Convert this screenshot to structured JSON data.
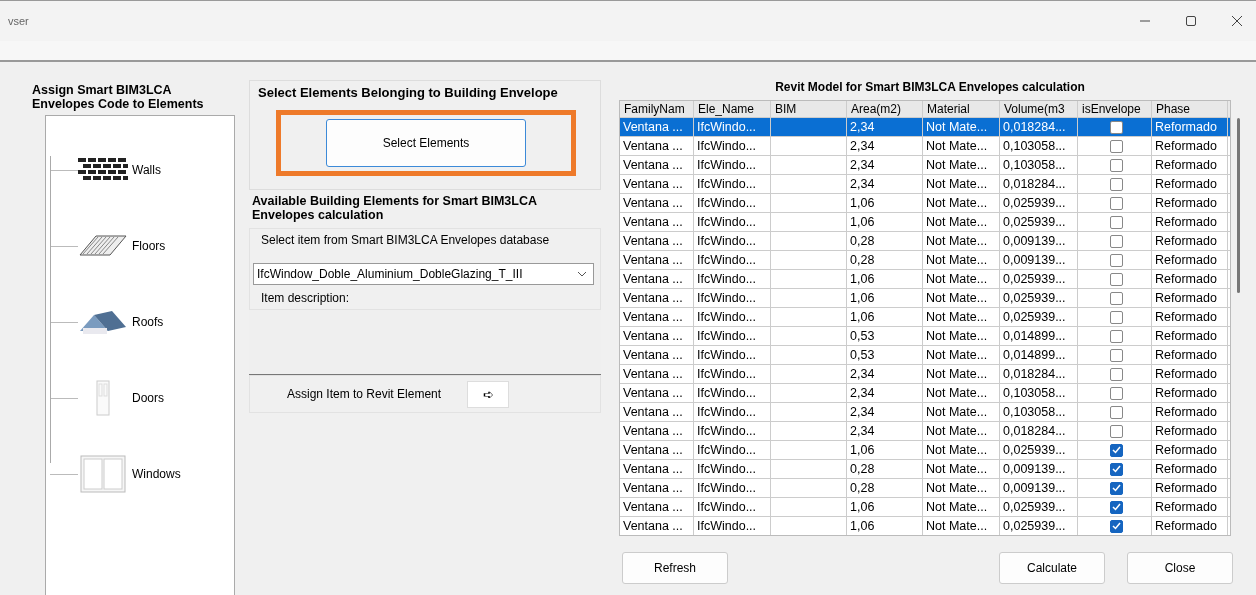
{
  "window": {
    "title": "vser"
  },
  "left_panel": {
    "title": "Assign Smart BIM3LCA Envelopes Code to Elements",
    "tree": [
      {
        "label": "Walls",
        "kind": "walls"
      },
      {
        "label": "Floors",
        "kind": "floors"
      },
      {
        "label": "Roofs",
        "kind": "roofs"
      },
      {
        "label": "Doors",
        "kind": "doors"
      },
      {
        "label": "Windows",
        "kind": "windows"
      }
    ]
  },
  "select_group": {
    "title": "Select Elements Belonging to Building Envelope",
    "button": "Select Elements",
    "highlighted": true
  },
  "available": {
    "title": "Available Building Elements for Smart BIM3LCA Envelopes calculation",
    "group_label": "Select item from Smart BIM3LCA Envelopes database",
    "dropdown_value": "IfcWindow_Doble_Aluminium_DobleGlazing_T_III",
    "description_label": "Item description:",
    "assign_label": "Assign Item to Revit Element",
    "assign_button": "➪"
  },
  "table": {
    "title": "Revit Model for Smart BIM3LCA Envelopes calculation",
    "columns": [
      "FamilyNam",
      "Ele_Name",
      "BIM",
      "Area(m2)",
      "Material",
      "Volume(m3",
      "isEnvelope",
      "Phase"
    ],
    "rows": [
      {
        "family": "Ventana ...",
        "name": "IfcWindo...",
        "bim": "",
        "area": "2,34",
        "material": "Not Mate...",
        "volume": "0,018284...",
        "is_envelope": false,
        "phase": "Reformado",
        "selected": true
      },
      {
        "family": "Ventana ...",
        "name": "IfcWindo...",
        "bim": "",
        "area": "2,34",
        "material": "Not Mate...",
        "volume": "0,103058...",
        "is_envelope": false,
        "phase": "Reformado",
        "selected": false
      },
      {
        "family": "Ventana ...",
        "name": "IfcWindo...",
        "bim": "",
        "area": "2,34",
        "material": "Not Mate...",
        "volume": "0,103058...",
        "is_envelope": false,
        "phase": "Reformado",
        "selected": false
      },
      {
        "family": "Ventana ...",
        "name": "IfcWindo...",
        "bim": "",
        "area": "2,34",
        "material": "Not Mate...",
        "volume": "0,018284...",
        "is_envelope": false,
        "phase": "Reformado",
        "selected": false
      },
      {
        "family": "Ventana ...",
        "name": "IfcWindo...",
        "bim": "",
        "area": "1,06",
        "material": "Not Mate...",
        "volume": "0,025939...",
        "is_envelope": false,
        "phase": "Reformado",
        "selected": false
      },
      {
        "family": "Ventana ...",
        "name": "IfcWindo...",
        "bim": "",
        "area": "1,06",
        "material": "Not Mate...",
        "volume": "0,025939...",
        "is_envelope": false,
        "phase": "Reformado",
        "selected": false
      },
      {
        "family": "Ventana ...",
        "name": "IfcWindo...",
        "bim": "",
        "area": "0,28",
        "material": "Not Mate...",
        "volume": "0,009139...",
        "is_envelope": false,
        "phase": "Reformado",
        "selected": false
      },
      {
        "family": "Ventana ...",
        "name": "IfcWindo...",
        "bim": "",
        "area": "0,28",
        "material": "Not Mate...",
        "volume": "0,009139...",
        "is_envelope": false,
        "phase": "Reformado",
        "selected": false
      },
      {
        "family": "Ventana ...",
        "name": "IfcWindo...",
        "bim": "",
        "area": "1,06",
        "material": "Not Mate...",
        "volume": "0,025939...",
        "is_envelope": false,
        "phase": "Reformado",
        "selected": false
      },
      {
        "family": "Ventana ...",
        "name": "IfcWindo...",
        "bim": "",
        "area": "1,06",
        "material": "Not Mate...",
        "volume": "0,025939...",
        "is_envelope": false,
        "phase": "Reformado",
        "selected": false
      },
      {
        "family": "Ventana ...",
        "name": "IfcWindo...",
        "bim": "",
        "area": "1,06",
        "material": "Not Mate...",
        "volume": "0,025939...",
        "is_envelope": false,
        "phase": "Reformado",
        "selected": false
      },
      {
        "family": "Ventana ...",
        "name": "IfcWindo...",
        "bim": "",
        "area": "0,53",
        "material": "Not Mate...",
        "volume": "0,014899...",
        "is_envelope": false,
        "phase": "Reformado",
        "selected": false
      },
      {
        "family": "Ventana ...",
        "name": "IfcWindo...",
        "bim": "",
        "area": "0,53",
        "material": "Not Mate...",
        "volume": "0,014899...",
        "is_envelope": false,
        "phase": "Reformado",
        "selected": false
      },
      {
        "family": "Ventana ...",
        "name": "IfcWindo...",
        "bim": "",
        "area": "2,34",
        "material": "Not Mate...",
        "volume": "0,018284...",
        "is_envelope": false,
        "phase": "Reformado",
        "selected": false
      },
      {
        "family": "Ventana ...",
        "name": "IfcWindo...",
        "bim": "",
        "area": "2,34",
        "material": "Not Mate...",
        "volume": "0,103058...",
        "is_envelope": false,
        "phase": "Reformado",
        "selected": false
      },
      {
        "family": "Ventana ...",
        "name": "IfcWindo...",
        "bim": "",
        "area": "2,34",
        "material": "Not Mate...",
        "volume": "0,103058...",
        "is_envelope": false,
        "phase": "Reformado",
        "selected": false
      },
      {
        "family": "Ventana ...",
        "name": "IfcWindo...",
        "bim": "",
        "area": "2,34",
        "material": "Not Mate...",
        "volume": "0,018284...",
        "is_envelope": false,
        "phase": "Reformado",
        "selected": false
      },
      {
        "family": "Ventana ...",
        "name": "IfcWindo...",
        "bim": "",
        "area": "1,06",
        "material": "Not Mate...",
        "volume": "0,025939...",
        "is_envelope": true,
        "phase": "Reformado",
        "selected": false
      },
      {
        "family": "Ventana ...",
        "name": "IfcWindo...",
        "bim": "",
        "area": "0,28",
        "material": "Not Mate...",
        "volume": "0,009139...",
        "is_envelope": true,
        "phase": "Reformado",
        "selected": false
      },
      {
        "family": "Ventana ...",
        "name": "IfcWindo...",
        "bim": "",
        "area": "0,28",
        "material": "Not Mate...",
        "volume": "0,009139...",
        "is_envelope": true,
        "phase": "Reformado",
        "selected": false
      },
      {
        "family": "Ventana ...",
        "name": "IfcWindo...",
        "bim": "",
        "area": "1,06",
        "material": "Not Mate...",
        "volume": "0,025939...",
        "is_envelope": true,
        "phase": "Reformado",
        "selected": false
      },
      {
        "family": "Ventana ...",
        "name": "IfcWindo...",
        "bim": "",
        "area": "1,06",
        "material": "Not Mate...",
        "volume": "0,025939...",
        "is_envelope": true,
        "phase": "Reformado",
        "selected": false
      }
    ]
  },
  "buttons": [
    "Refresh",
    "Calculate",
    "Close"
  ]
}
